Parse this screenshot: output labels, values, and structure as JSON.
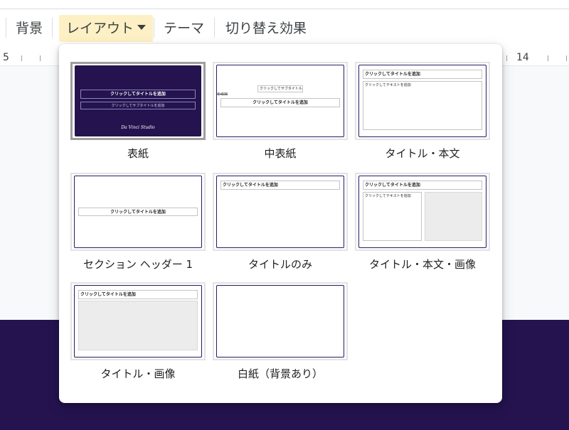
{
  "toolbar": {
    "background_label": "背景",
    "layout_label": "レイアウト",
    "theme_label": "テーマ",
    "transition_label": "切り替え効果"
  },
  "ruler": {
    "left_number": "5",
    "right_number": "14"
  },
  "layouts": [
    {
      "label": "表紙",
      "selected": true,
      "title_ph": "クリックしてタイトルを追加",
      "subtitle_ph": "クリックしてサブタイトルを追加",
      "brand": "Da Vinci Studio"
    },
    {
      "label": "中表紙",
      "subtitle_ph": "クリックしてサブタイトル",
      "subtitle_extra": "を追加",
      "title_ph": "クリックしてタイトルを追加"
    },
    {
      "label": "タイトル・本文",
      "title_ph": "クリックしてタイトルを追加",
      "body_ph": "クリックしてテキストを追加"
    },
    {
      "label": "セクション ヘッダー 1",
      "title_ph": "クリックしてタイトルを追加"
    },
    {
      "label": "タイトルのみ",
      "title_ph": "クリックしてタイトルを追加"
    },
    {
      "label": "タイトル・本文・画像",
      "title_ph": "クリックしてタイトルを追加",
      "body_ph": "クリックしてテキストを追加"
    },
    {
      "label": "タイトル・画像",
      "title_ph": "クリックしてタイトルを追加"
    },
    {
      "label": "白紙（背景あり）"
    }
  ],
  "colors": {
    "slide_background": "#24134f",
    "active_menu_highlight": "#fdf0c4"
  }
}
